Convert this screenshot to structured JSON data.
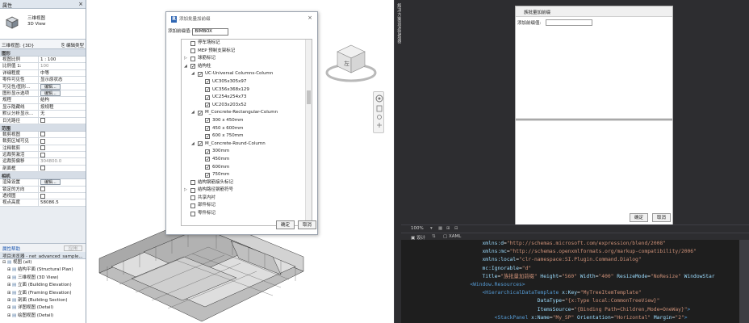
{
  "properties": {
    "title": "属性",
    "type_line1": "三维视图",
    "type_line2": "3D View",
    "type_selector": "三维视图: {3D}",
    "edit_type": "编辑类型",
    "groups": {
      "graphics": "图形",
      "extents": "范围",
      "camera": "相机"
    },
    "rows_graphics": [
      {
        "k": "视图比例",
        "v": "1 : 100"
      },
      {
        "k": "比例值 1:",
        "v": "100",
        "gray": true
      },
      {
        "k": "详细程度",
        "v": "中等"
      },
      {
        "k": "零件可见性",
        "v": "显示原状态"
      },
      {
        "k": "可见性/图形...",
        "v": "编辑...",
        "btn": true
      },
      {
        "k": "图形显示选项",
        "v": "编辑...",
        "btn": true
      },
      {
        "k": "规程",
        "v": "结构"
      },
      {
        "k": "显示隐藏线",
        "v": "按规程"
      },
      {
        "k": "默认分析显示...",
        "v": "无"
      },
      {
        "k": "日光路径",
        "v": "",
        "cb": true
      }
    ],
    "rows_extents": [
      {
        "k": "裁剪视图",
        "v": "",
        "cb": true
      },
      {
        "k": "裁剪区域可见",
        "v": "",
        "cb": true
      },
      {
        "k": "注释裁剪",
        "v": "",
        "cb": true
      },
      {
        "k": "远裁剪激活",
        "v": "",
        "cb": true
      },
      {
        "k": "远裁剪偏移",
        "v": "304800.0",
        "gray": true
      },
      {
        "k": "剖面框",
        "v": "",
        "cb": true
      }
    ],
    "rows_camera": [
      {
        "k": "渲染设置",
        "v": "编辑...",
        "btn": true
      },
      {
        "k": "锁定的方向",
        "v": "",
        "cb": true
      },
      {
        "k": "透视图",
        "v": "",
        "cb": true
      },
      {
        "k": "视点高度",
        "v": "58086.5"
      }
    ],
    "help_link": "属性帮助",
    "apply": "应用"
  },
  "browser": {
    "title": "项目浏览器 - net_advanced_sample...",
    "items": [
      {
        "label": "视图 (all)",
        "indent": 0,
        "exp": "⊟"
      },
      {
        "label": "结构平面 (Structural Plan)",
        "indent": 1,
        "exp": "⊞"
      },
      {
        "label": "三维视图 (3D View)",
        "indent": 1,
        "exp": "⊞"
      },
      {
        "label": "立面 (Building Elevation)",
        "indent": 1,
        "exp": "⊞"
      },
      {
        "label": "立面 (Framing Elevation)",
        "indent": 1,
        "exp": "⊞"
      },
      {
        "label": "剖面 (Building Section)",
        "indent": 1,
        "exp": "⊞"
      },
      {
        "label": "详图视图 (Detail)",
        "indent": 1,
        "exp": "⊞"
      },
      {
        "label": "绘图视图 (Detail)",
        "indent": 1,
        "exp": "⊞"
      }
    ]
  },
  "dialog": {
    "title": "添加批量加前缀",
    "field_label": "添加前缀值:",
    "field_value": "BIMBOX",
    "tree": [
      {
        "label": "停车场标记",
        "level": 0,
        "arrow": "",
        "checked": false
      },
      {
        "label": "MEP 预制支架标记",
        "level": 0,
        "arrow": "",
        "checked": false
      },
      {
        "label": "球筋标记",
        "level": 0,
        "arrow": "▷",
        "checked": false
      },
      {
        "label": "结构柱",
        "level": 0,
        "arrow": "◢",
        "checked": true
      },
      {
        "label": "UC-Universal Columns-Column",
        "level": 1,
        "arrow": "◢",
        "checked": true
      },
      {
        "label": "UC305x305x97",
        "level": 2,
        "arrow": "",
        "checked": true
      },
      {
        "label": "UC356x368x129",
        "level": 2,
        "arrow": "",
        "checked": true
      },
      {
        "label": "UC254x254x73",
        "level": 2,
        "arrow": "",
        "checked": true
      },
      {
        "label": "UC203x203x52",
        "level": 2,
        "arrow": "",
        "checked": true
      },
      {
        "label": "M_Concrete-Rectangular-Column",
        "level": 1,
        "arrow": "◢",
        "checked": true
      },
      {
        "label": "300 x 450mm",
        "level": 2,
        "arrow": "",
        "checked": true
      },
      {
        "label": "450 x 600mm",
        "level": 2,
        "arrow": "",
        "checked": true
      },
      {
        "label": "600 x 750mm",
        "level": 2,
        "arrow": "",
        "checked": true
      },
      {
        "label": "M_Concrete-Round-Column",
        "level": 1,
        "arrow": "◢",
        "checked": true
      },
      {
        "label": "300mm",
        "level": 2,
        "arrow": "",
        "checked": true
      },
      {
        "label": "450mm",
        "level": 2,
        "arrow": "",
        "checked": true
      },
      {
        "label": "600mm",
        "level": 2,
        "arrow": "",
        "checked": true
      },
      {
        "label": "750mm",
        "level": 2,
        "arrow": "",
        "checked": true
      },
      {
        "label": "结构钢筋接头标记",
        "level": 0,
        "arrow": "",
        "checked": false
      },
      {
        "label": "结构路径钢筋符号",
        "level": 0,
        "arrow": "▷",
        "checked": false
      },
      {
        "label": "共享内衬",
        "level": 0,
        "arrow": "",
        "checked": false
      },
      {
        "label": "部件标记",
        "level": 0,
        "arrow": "",
        "checked": false
      },
      {
        "label": "零件标记",
        "level": 0,
        "arrow": "",
        "checked": false
      }
    ],
    "ok": "确定",
    "cancel": "取消"
  },
  "viewcube": {
    "face_label": "左"
  },
  "splitter_text": "解决方案资源管理器",
  "designer": {
    "window_title": "族批量加前缀",
    "field_label": "添加前缀值:",
    "ok": "确定",
    "cancel": "取消"
  },
  "zoom": "100%",
  "tabs": {
    "design": "设计",
    "xaml": "XAML"
  },
  "code_lines": [
    [
      {
        "c": "c-attr",
        "t": "xmlns:d"
      },
      {
        "c": "c-txt",
        "t": "="
      },
      {
        "c": "c-str",
        "t": "\"http://schemas.microsoft.com/expression/blend/2008\""
      }
    ],
    [
      {
        "c": "c-attr",
        "t": "xmlns:mc"
      },
      {
        "c": "c-txt",
        "t": "="
      },
      {
        "c": "c-str",
        "t": "\"http://schemas.openxmlformats.org/markup-compatibility/2006\""
      }
    ],
    [
      {
        "c": "c-attr",
        "t": "xmlns:local"
      },
      {
        "c": "c-txt",
        "t": "="
      },
      {
        "c": "c-str",
        "t": "\"clr-namespace:SI.Plugin.Command.Dialog\""
      }
    ],
    [
      {
        "c": "c-attr",
        "t": "mc:Ignorable"
      },
      {
        "c": "c-txt",
        "t": "="
      },
      {
        "c": "c-str",
        "t": "\"d\""
      }
    ],
    [
      {
        "c": "c-attr",
        "t": "Title"
      },
      {
        "c": "c-txt",
        "t": "="
      },
      {
        "c": "c-str",
        "t": "\"族批量加前缀\""
      },
      {
        "c": "c-attr",
        "t": " Height"
      },
      {
        "c": "c-txt",
        "t": "="
      },
      {
        "c": "c-str",
        "t": "\"560\""
      },
      {
        "c": "c-attr",
        "t": " Width"
      },
      {
        "c": "c-txt",
        "t": "="
      },
      {
        "c": "c-str",
        "t": "\"400\""
      },
      {
        "c": "c-attr",
        "t": " ResizeMode"
      },
      {
        "c": "c-txt",
        "t": "="
      },
      {
        "c": "c-str",
        "t": "\"NoResize\""
      },
      {
        "c": "c-attr",
        "t": " WindowStar"
      }
    ],
    [
      {
        "c": "c-tag",
        "t": "<Window.Resources>"
      }
    ],
    [
      {
        "c": "c-tag",
        "t": "    <HierarchicalDataTemplate"
      },
      {
        "c": "c-attr",
        "t": " x:Key"
      },
      {
        "c": "c-txt",
        "t": "="
      },
      {
        "c": "c-str",
        "t": "\"MyTreeItemTemplate\""
      }
    ],
    [
      {
        "c": "c-attr",
        "t": "                              DataType"
      },
      {
        "c": "c-txt",
        "t": "="
      },
      {
        "c": "c-str",
        "t": "\"{x:Type local:CommonTreeView}\""
      }
    ],
    [
      {
        "c": "c-attr",
        "t": "                              ItemsSource"
      },
      {
        "c": "c-txt",
        "t": "="
      },
      {
        "c": "c-str",
        "t": "\"{Binding Path=Children,Mode=OneWay}\""
      },
      {
        "c": "c-tag",
        "t": ">"
      }
    ],
    [
      {
        "c": "c-tag",
        "t": "        <StackPanel"
      },
      {
        "c": "c-attr",
        "t": " x:Name"
      },
      {
        "c": "c-txt",
        "t": "="
      },
      {
        "c": "c-str",
        "t": "\"My_SP\""
      },
      {
        "c": "c-attr",
        "t": " Orientation"
      },
      {
        "c": "c-txt",
        "t": "="
      },
      {
        "c": "c-str",
        "t": "\"Horizontal\""
      },
      {
        "c": "c-attr",
        "t": " Margin"
      },
      {
        "c": "c-txt",
        "t": "="
      },
      {
        "c": "c-str",
        "t": "\"2\""
      },
      {
        "c": "c-tag",
        "t": ">"
      }
    ]
  ],
  "code_indent": [
    "            ",
    "            ",
    "            ",
    "            ",
    "            ",
    "        ",
    "        ",
    "",
    "",
    "        "
  ]
}
